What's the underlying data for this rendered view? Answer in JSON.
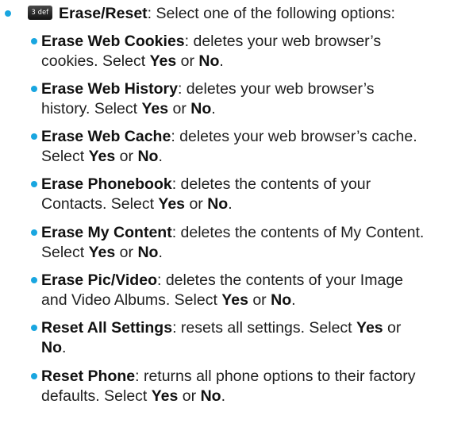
{
  "section": {
    "key_icon_label": "3 def",
    "title": "Erase/Reset",
    "intro": ": Select one of the following options:"
  },
  "options": [
    {
      "name": "Erase Web Cookies",
      "l1": ": deletes your web browser’s",
      "l2a": "cookies. Select ",
      "yes": "Yes",
      "or": " or ",
      "no": "No",
      "end": "."
    },
    {
      "name": "Erase Web History",
      "l1": ": deletes your web browser’s",
      "l2a": "history. Select ",
      "yes": "Yes",
      "or": " or ",
      "no": "No",
      "end": "."
    },
    {
      "name": "Erase Web Cache",
      "l1": ": deletes your web browser’s cache.",
      "l2a": "Select ",
      "yes": "Yes",
      "or": " or ",
      "no": "No",
      "end": "."
    },
    {
      "name": "Erase Phonebook",
      "l1": ": deletes the contents of your",
      "l2a": "Contacts. Select ",
      "yes": "Yes",
      "or": " or ",
      "no": "No",
      "end": "."
    },
    {
      "name": "Erase My Content",
      "l1": ": deletes the contents of My Content.",
      "l2a": "Select ",
      "yes": "Yes",
      "or": " or ",
      "no": "No",
      "end": "."
    },
    {
      "name": "Erase Pic/Video",
      "l1": ": deletes the contents of your Image",
      "l2a": "and Video Albums. Select ",
      "yes": "Yes",
      "or": " or ",
      "no": "No",
      "end": "."
    },
    {
      "name": "Reset All Settings",
      "l1": ": resets all settings. Select ",
      "yes": "Yes",
      "or": " or",
      "no": "No",
      "end": "."
    },
    {
      "name": "Reset Phone",
      "l1": ": returns all phone options to their factory",
      "l2a": "defaults. Select ",
      "yes": "Yes",
      "or": " or ",
      "no": "No",
      "end": "."
    }
  ]
}
